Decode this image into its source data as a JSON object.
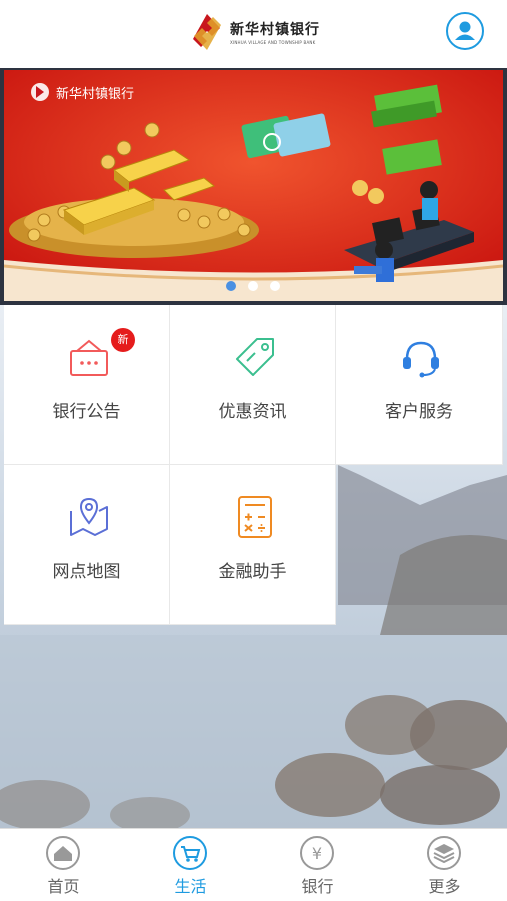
{
  "header": {
    "logo_cn": "新华村镇银行",
    "logo_en": "XINHUA VILLAGE AND TOWNSHIP BANK",
    "user_icon": "user-icon"
  },
  "banner": {
    "logo_cn": "新华村镇银行",
    "active_slide": 1,
    "slide_count": 3
  },
  "menu": [
    {
      "label": "银行公告",
      "icon": "announcement-icon",
      "badge": "新",
      "color": "#f25a5a"
    },
    {
      "label": "优惠资讯",
      "icon": "tag-icon",
      "color": "#3bbf8f"
    },
    {
      "label": "客户服务",
      "icon": "headset-icon",
      "color": "#2f7fe0"
    },
    {
      "label": "网点地图",
      "icon": "map-pin-icon",
      "color": "#5b6fd6"
    },
    {
      "label": "金融助手",
      "icon": "calculator-icon",
      "color": "#ef8a22"
    }
  ],
  "tabbar": [
    {
      "label": "首页",
      "icon": "home-icon"
    },
    {
      "label": "生活",
      "icon": "cart-icon",
      "active": true
    },
    {
      "label": "银行",
      "icon": "yen-icon"
    },
    {
      "label": "更多",
      "icon": "layers-icon"
    }
  ],
  "colors": {
    "accent": "#1e9be0",
    "badge": "#e51c1c",
    "banner_red": "#d8241a"
  }
}
